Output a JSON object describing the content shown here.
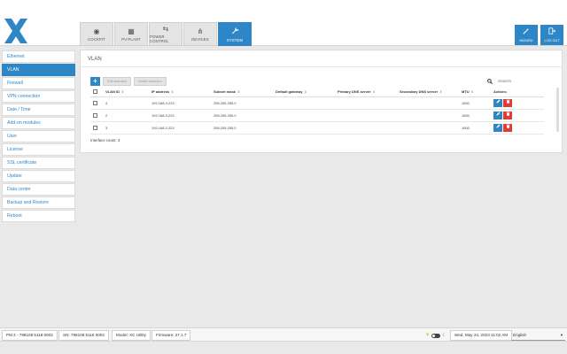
{
  "header": {
    "nav_tabs": [
      {
        "label": "COCKPIT",
        "icon": "target-icon",
        "glyph": "◉"
      },
      {
        "label": "PV-PLANT",
        "icon": "solar-panel-icon",
        "glyph": "▦"
      },
      {
        "label": "POWER CONTROL",
        "icon": "power-control-icon",
        "glyph": "⇆"
      },
      {
        "label": "DEVICES",
        "icon": "devices-icon",
        "glyph": "⋔"
      },
      {
        "label": "SYSTEM",
        "icon": "wrench-icon",
        "glyph": "🔧"
      }
    ],
    "active_tab": "SYSTEM",
    "wizard_label": "WIZARD",
    "logout_label": "LOG OUT"
  },
  "sidebar": {
    "items": [
      "Ethernet",
      "VLAN",
      "Firewall",
      "VPN connection",
      "Date / Time",
      "Add-on modules",
      "User",
      "License",
      "SSL certificate",
      "Update",
      "Data center",
      "Backup and Restore",
      "Reboot"
    ],
    "active": "VLAN"
  },
  "main": {
    "title": "VLAN",
    "edit_selected": "Edit selected",
    "delete_selection": "Delete selection",
    "search_placeholder": "Search",
    "columns": [
      "VLAN ID",
      "IP address",
      "Subnet mask",
      "Default gateway",
      "Primary DNS server",
      "Secondary DNS server",
      "MTU",
      "Actions"
    ],
    "rows": [
      {
        "vlan_id": "4",
        "ip": "192.168.4.223",
        "mask": "255.255.255.0",
        "gateway": "",
        "dns1": "",
        "dns2": "",
        "mtu": "1500"
      },
      {
        "vlan_id": "2",
        "ip": "192.168.3.223",
        "mask": "255.255.255.0",
        "gateway": "",
        "dns1": "",
        "dns2": "",
        "mtu": "1500"
      },
      {
        "vlan_id": "3",
        "ip": "192.168.2.223",
        "mask": "255.255.255.0",
        "gateway": "",
        "dns1": "",
        "dns2": "",
        "mtu": "1500"
      }
    ],
    "interface_count": "Interface count: 3"
  },
  "footer": {
    "pm": "PM 2 - 798108 5118 0002",
    "sn": "SN: 798108 5118 0002",
    "model": "Model: XC Utility",
    "firmware": "Firmware: 27.1.7",
    "datetime": "Wed, May 24, 2023 11:02 AM",
    "language": "English"
  },
  "colors": {
    "accent": "#2f86c6",
    "danger": "#e53935"
  }
}
